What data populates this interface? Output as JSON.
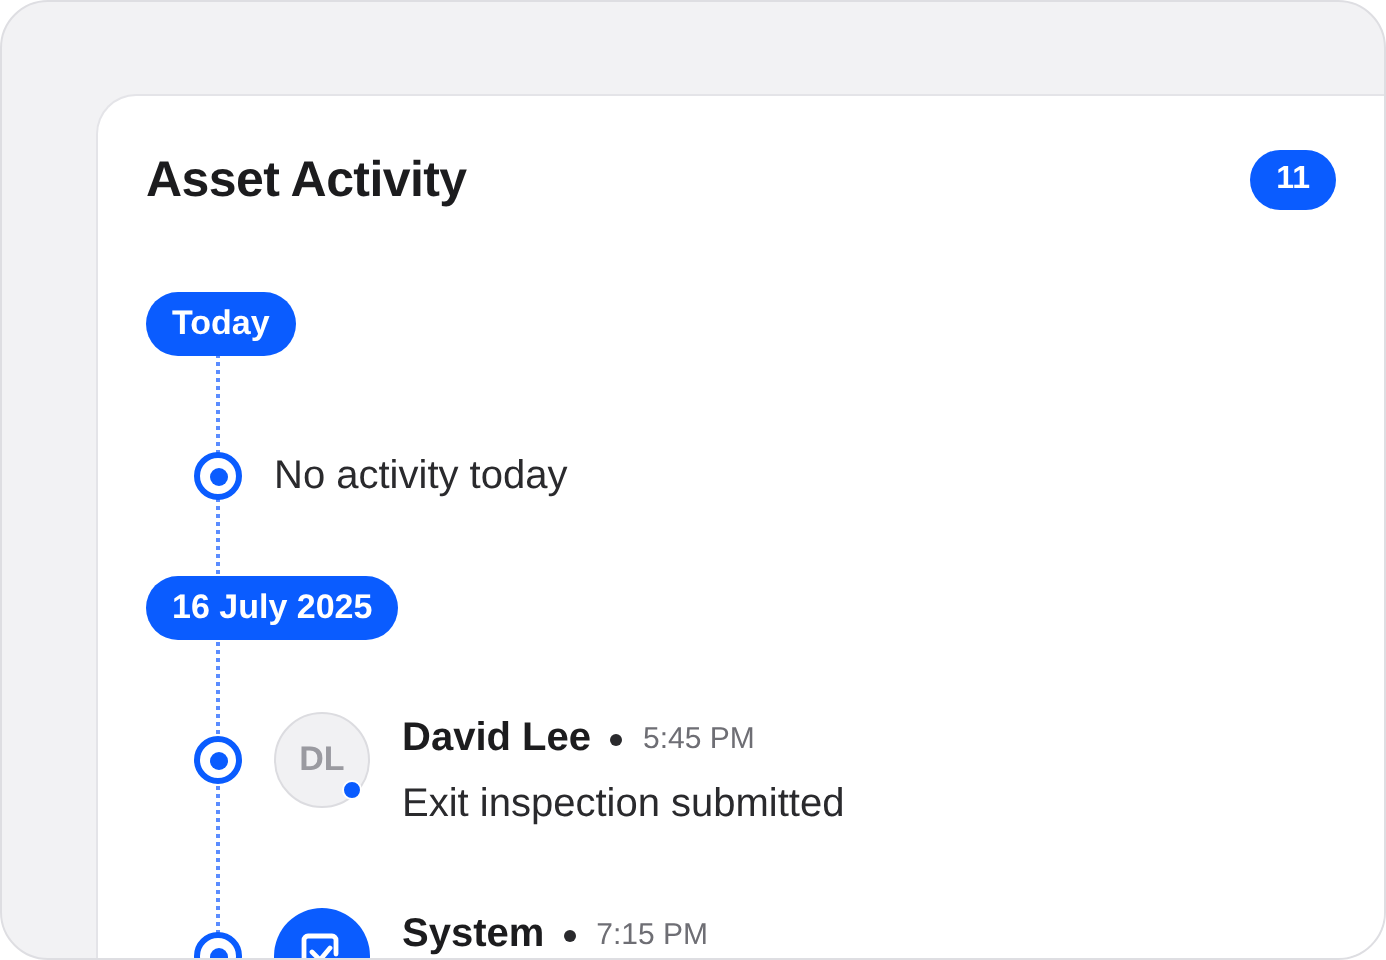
{
  "card": {
    "title": "Asset Activity",
    "count": "11"
  },
  "groups": [
    {
      "date": "Today",
      "entries": [
        {
          "kind": "empty",
          "text": "No activity today"
        }
      ]
    },
    {
      "date": "16 July 2025",
      "entries": [
        {
          "kind": "user",
          "initials": "DL",
          "online": true,
          "author": "David Lee",
          "time": "5:45 PM",
          "text": "Exit inspection submitted"
        },
        {
          "kind": "system",
          "author": "System",
          "time": "7:15 PM"
        }
      ]
    }
  ]
}
